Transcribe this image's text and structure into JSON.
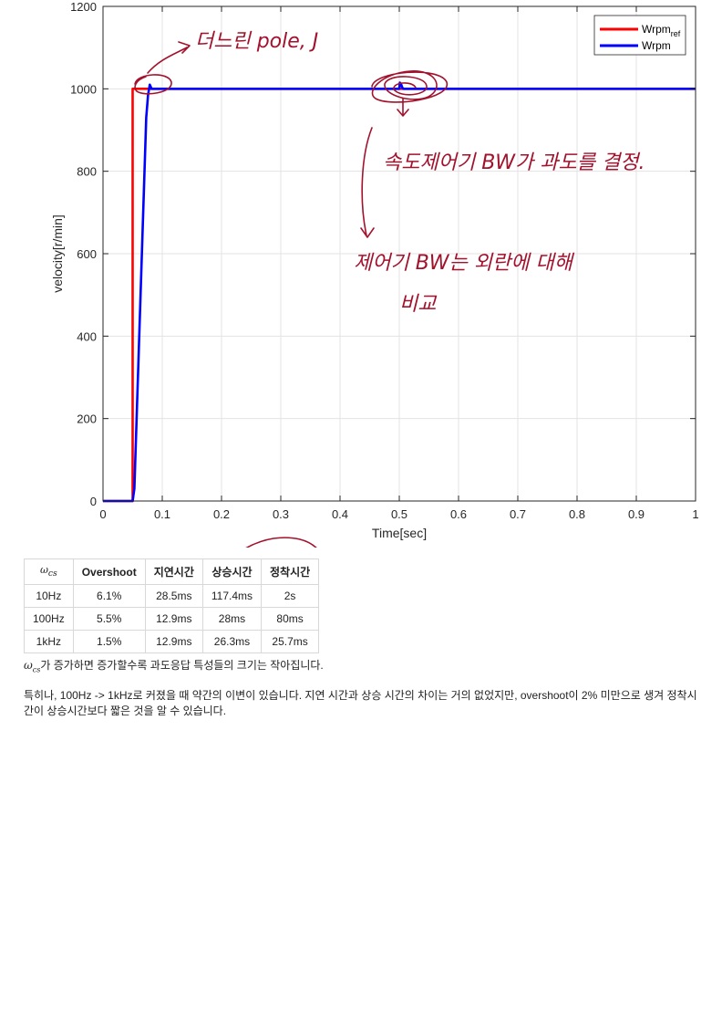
{
  "chart_data": {
    "type": "line",
    "xlabel": "Time[sec]",
    "ylabel": "velocity[r/min]",
    "xlim": [
      0,
      1
    ],
    "ylim": [
      0,
      1200
    ],
    "xticks": [
      0,
      0.1,
      0.2,
      0.3,
      0.4,
      0.5,
      0.6,
      0.7,
      0.8,
      0.9,
      1
    ],
    "xtick_labels": [
      "0",
      "0.1",
      "0.2",
      "0.3",
      "0.4",
      "0.5",
      "0.6",
      "0.7",
      "0.8",
      "0.9",
      "1"
    ],
    "yticks": [
      0,
      200,
      400,
      600,
      800,
      1000,
      1200
    ],
    "ytick_labels": [
      "0",
      "200",
      "400",
      "600",
      "800",
      "1000",
      "1200"
    ],
    "grid": true,
    "legend_position": "top-right",
    "series": [
      {
        "name": "Wrpm",
        "name_sub": "ref",
        "color": "#ff0000",
        "x": [
          0,
          0.05,
          0.05,
          1
        ],
        "y": [
          0,
          0,
          1000,
          1000
        ]
      },
      {
        "name": "Wrpm",
        "name_sub": "",
        "color": "#0000ff",
        "x": [
          0,
          0.05,
          0.053,
          0.073,
          0.076,
          0.079,
          0.082,
          0.1,
          0.5,
          0.501,
          0.503,
          0.505,
          0.507,
          1
        ],
        "y": [
          0,
          0,
          30,
          930,
          985,
          1010,
          1000,
          1000,
          1000,
          1015,
          1012,
          1003,
          1000,
          1000
        ]
      }
    ],
    "annotations": [
      "더느린 pole, J",
      "속도제어기 BW가 과도를 결정.",
      "제어기 BW는 외란에 대해",
      "비교"
    ]
  },
  "table": {
    "headers": [
      "ω_cs",
      "Overshoot",
      "지연시간",
      "상승시간",
      "정착시간"
    ],
    "rows": [
      [
        "10Hz",
        "6.1%",
        "28.5ms",
        "117.4ms",
        "2s"
      ],
      [
        "100Hz",
        "5.5%",
        "12.9ms",
        "28ms",
        "80ms"
      ],
      [
        "1kHz",
        "1.5%",
        "12.9ms",
        "26.3ms",
        "25.7ms"
      ]
    ]
  },
  "text": {
    "omega_symbol": "ω",
    "omega_sub": "cs",
    "para1_rest": "가 증가하면 증가할수록 과도응답 특성들의 크기는 작아집니다.",
    "para2": "특히나, 100Hz -> 1kHz로 커졌을 때 약간의 이변이 있습니다. 지연 시간과 상승 시간의 차이는 거의 없었지만, overshoot이 2% 미만으로 생겨 정착시간이 상승시간보다 짧은 것을 알 수 있습니다."
  }
}
